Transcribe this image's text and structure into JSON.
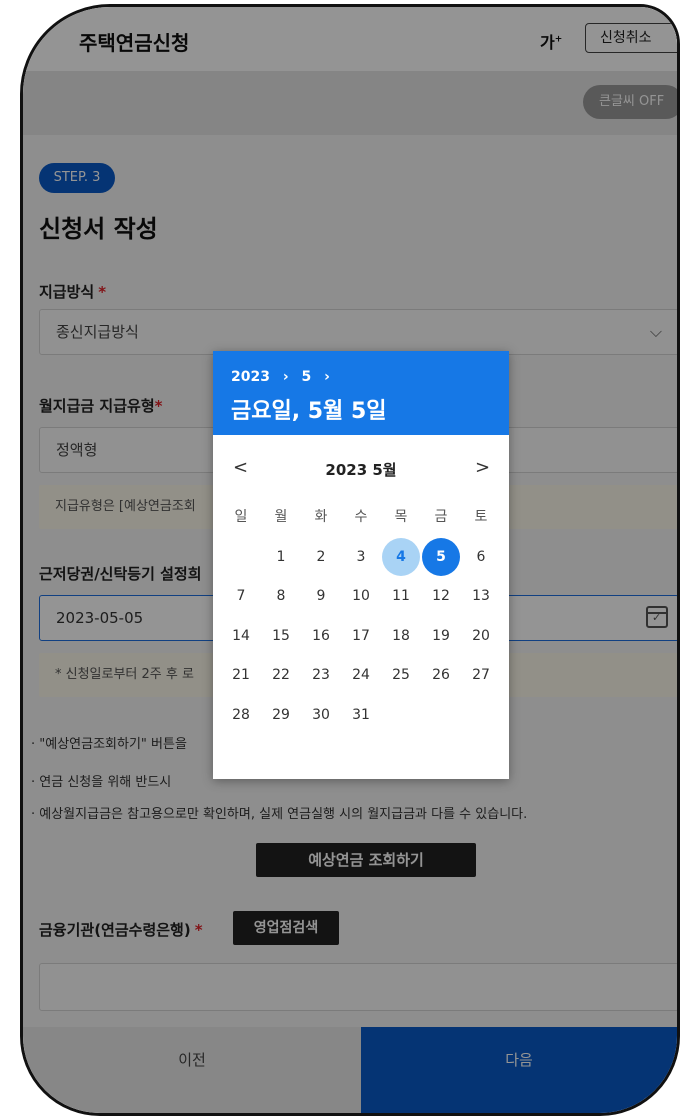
{
  "header": {
    "title": "주택연금신청",
    "font_size_label": "가",
    "cancel_label": "신청취소"
  },
  "subbar": {
    "big_font_toggle": "큰글씨 OFF"
  },
  "step": {
    "badge": "STEP. 3",
    "title": "신청서 작성"
  },
  "form": {
    "payment_method": {
      "label": "지급방식",
      "value": "종신지급방식"
    },
    "monthly_type": {
      "label": "월지급금 지급유형",
      "value": "정액형",
      "note": "지급유형은 [예상연금조회"
    },
    "mortgage_date": {
      "label": "근저당권/신탁등기 설정희",
      "value": "2023-05-05",
      "note": "* 신청일로부터 2주 후 로"
    }
  },
  "bullets": [
    "· \"예상연금조회하기\" 버튼을",
    "· 연금 신청을 위해 반드시",
    "· 예상월지급금은 참고용으로만 확인하며, 실제 연금실행 시의 월지급금과 다를 수 있습니다."
  ],
  "estimate_button": "예상연금 조회하기",
  "bank": {
    "label": "금융기관(연금수령은행)",
    "search_button": "영업점검색"
  },
  "footer": {
    "prev": "이전",
    "next": "다음"
  },
  "date_picker": {
    "crumb_year": "2023",
    "crumb_month": "5",
    "selected_display": "금요일, 5월 5일",
    "month_label": "2023 5월",
    "prev_icon": "<",
    "next_icon": ">",
    "weekdays": [
      "일",
      "월",
      "화",
      "수",
      "목",
      "금",
      "토"
    ],
    "days": [
      "1",
      "2",
      "3",
      "4",
      "5",
      "6",
      "7",
      "8",
      "9",
      "10",
      "11",
      "12",
      "13",
      "14",
      "15",
      "16",
      "17",
      "18",
      "19",
      "20",
      "21",
      "22",
      "23",
      "24",
      "25",
      "26",
      "27",
      "28",
      "29",
      "30",
      "31"
    ],
    "first_weekday": 1,
    "hover_day": 4,
    "selected_day": 5
  },
  "colors": {
    "primary": "#1678e6",
    "badge": "#0a5ac8",
    "required": "#e0232a"
  }
}
